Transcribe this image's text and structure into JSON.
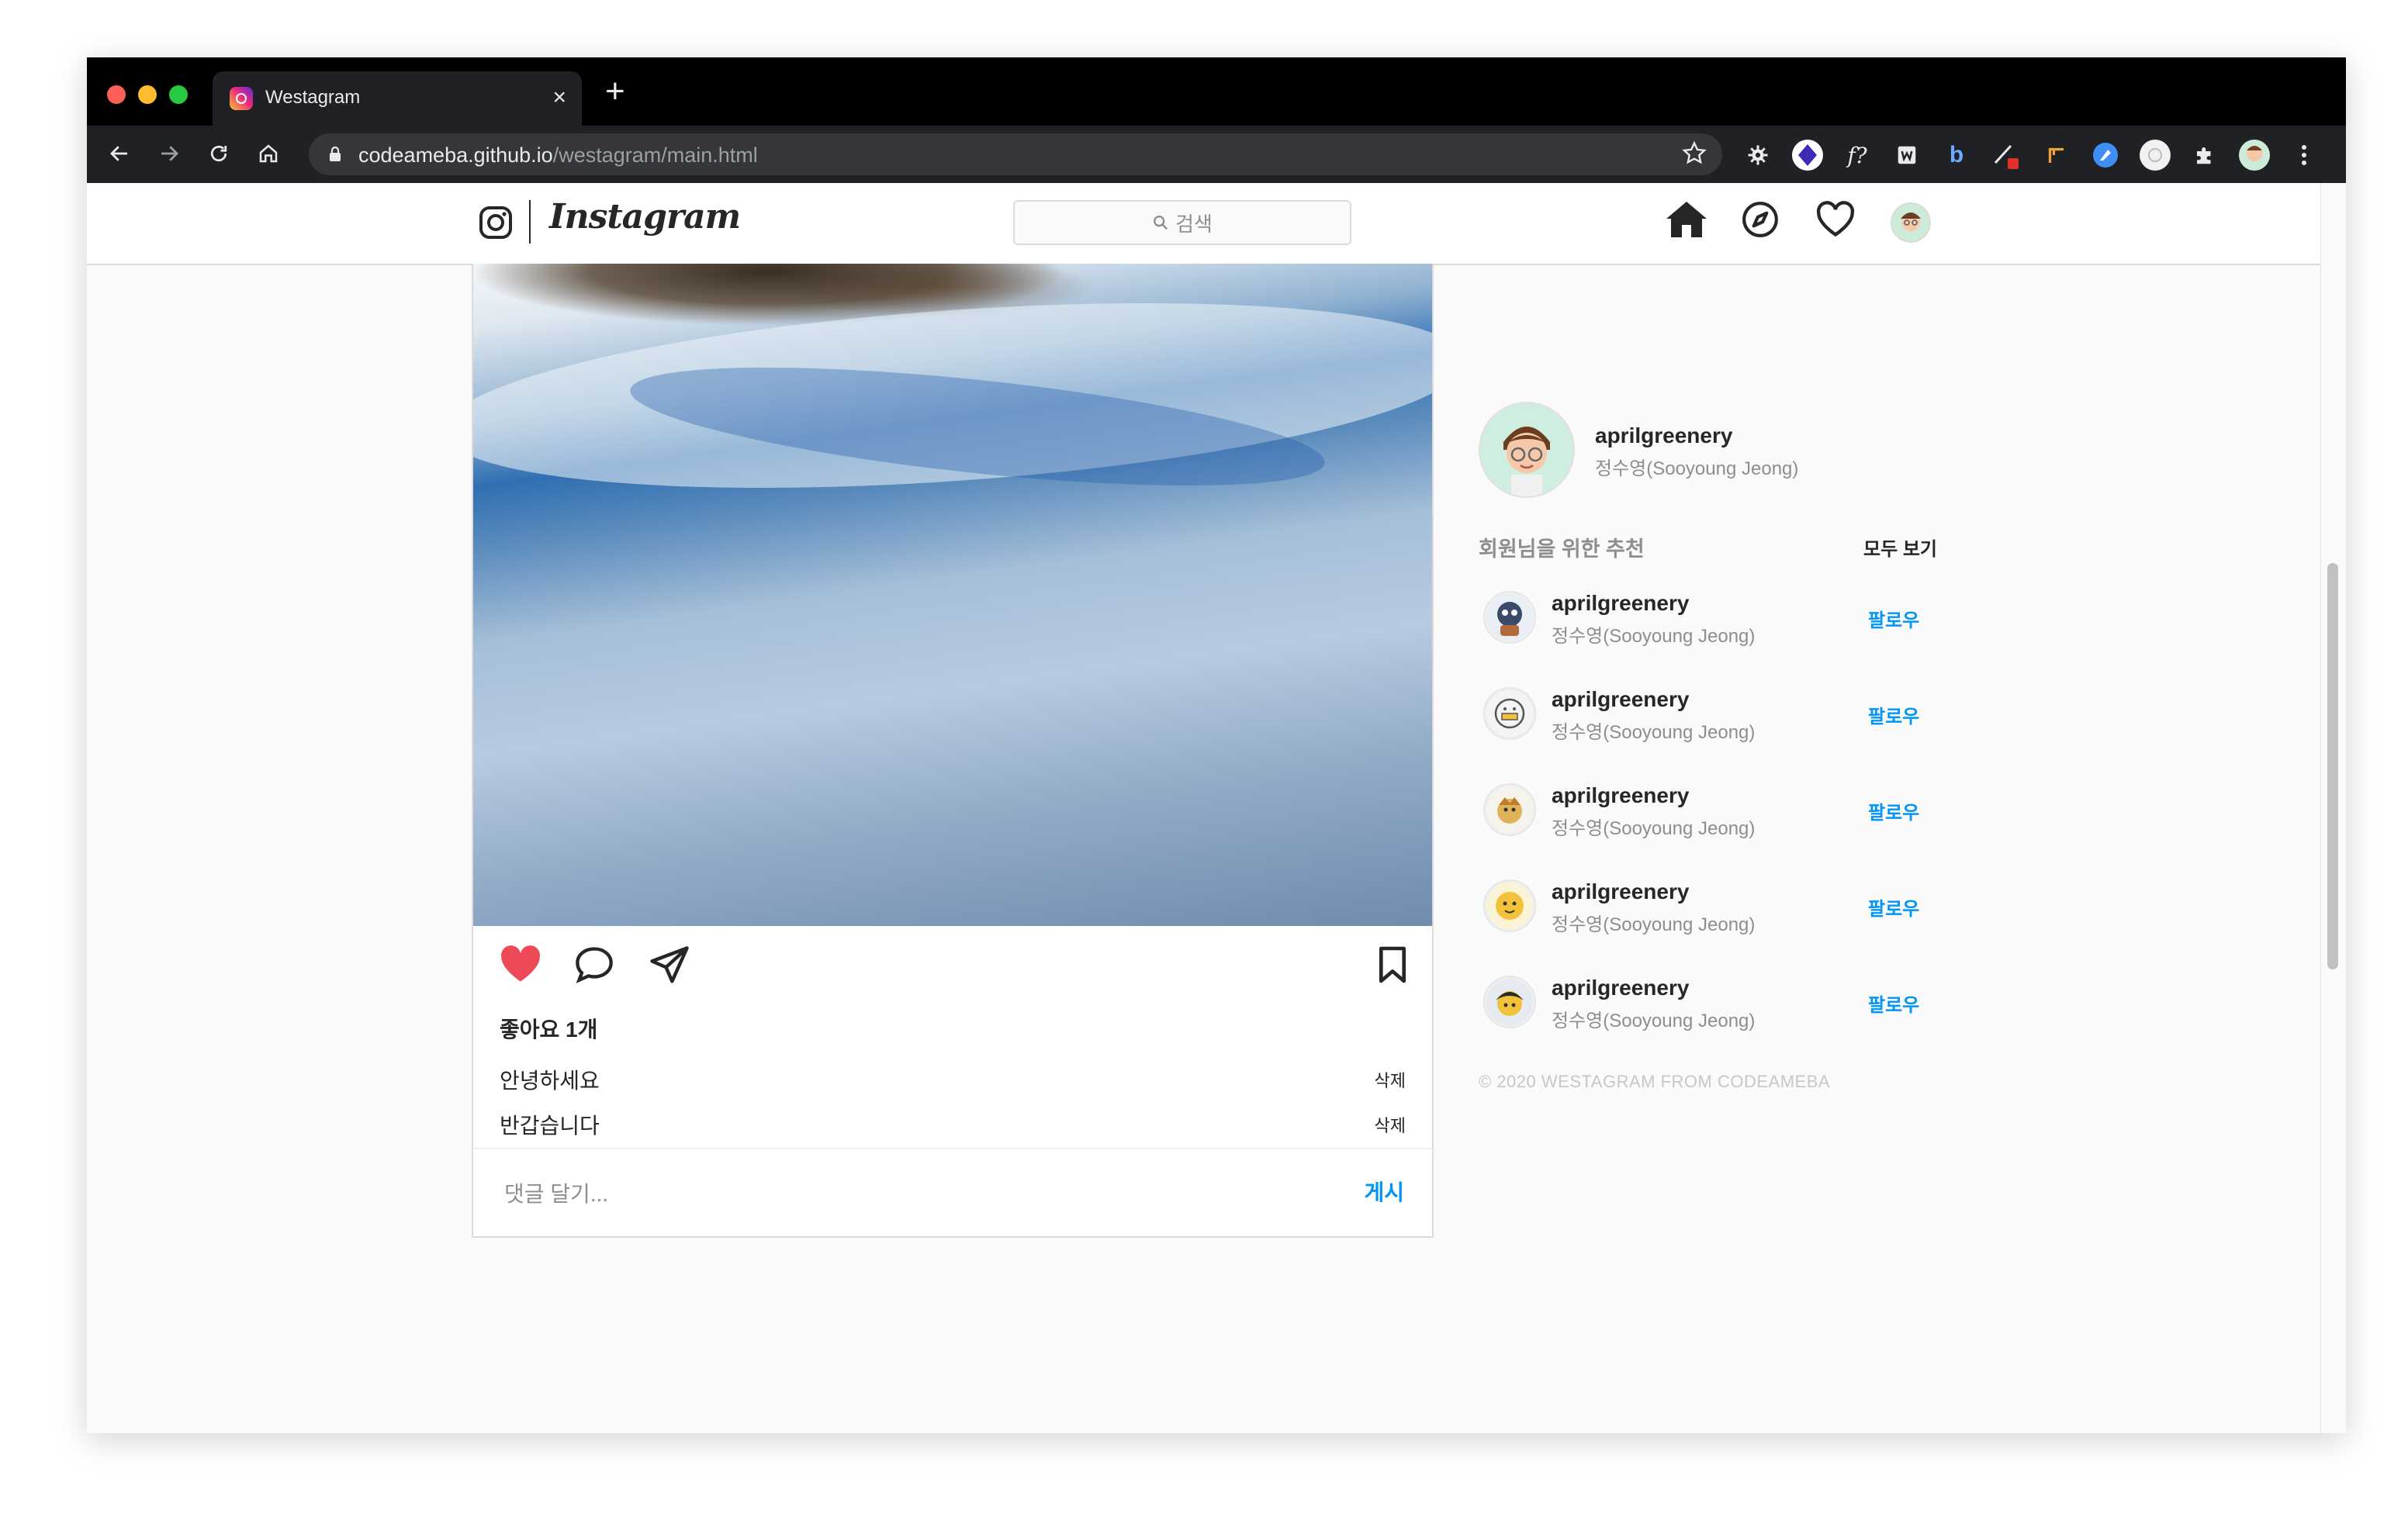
{
  "browser": {
    "tab_title": "Westagram",
    "url_host": "codeameba.github.io",
    "url_path": "/westagram/main.html"
  },
  "header": {
    "logo_text": "Instagram",
    "search_placeholder": "검색"
  },
  "post": {
    "likes": "좋아요 1개",
    "comments": [
      {
        "text": "안녕하세요",
        "delete": "삭제"
      },
      {
        "text": "반갑습니다",
        "delete": "삭제"
      }
    ],
    "comment_placeholder": "댓글 달기...",
    "post_button": "게시"
  },
  "sidebar": {
    "me": {
      "username": "aprilgreenery",
      "fullname": "정수영(Sooyoung Jeong)"
    },
    "recommend_title": "회원님을 위한 추천",
    "see_all": "모두 보기",
    "recommendations": [
      {
        "username": "aprilgreenery",
        "fullname": "정수영(Sooyoung Jeong)",
        "action": "팔로우"
      },
      {
        "username": "aprilgreenery",
        "fullname": "정수영(Sooyoung Jeong)",
        "action": "팔로우"
      },
      {
        "username": "aprilgreenery",
        "fullname": "정수영(Sooyoung Jeong)",
        "action": "팔로우"
      },
      {
        "username": "aprilgreenery",
        "fullname": "정수영(Sooyoung Jeong)",
        "action": "팔로우"
      },
      {
        "username": "aprilgreenery",
        "fullname": "정수영(Sooyoung Jeong)",
        "action": "팔로우"
      }
    ],
    "copyright": "© 2020 WESTAGRAM FROM CODEAMEBA"
  },
  "colors": {
    "accent": "#0095f6",
    "like": "#ed4956"
  },
  "icons": [
    "instagram-icon",
    "search-icon",
    "home-icon",
    "compass-icon",
    "heart-icon",
    "comment-icon",
    "share-icon",
    "bookmark-icon"
  ]
}
